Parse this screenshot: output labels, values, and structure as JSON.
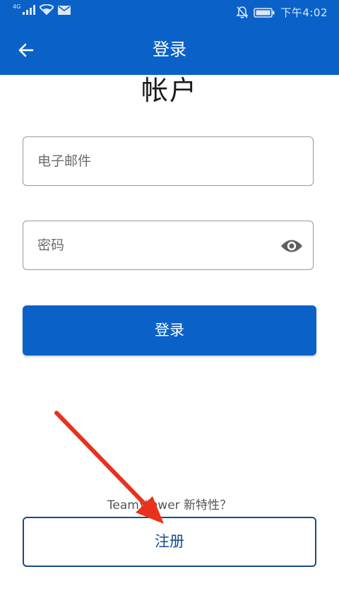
{
  "status_bar": {
    "network_type": "4G",
    "time": "下午4:02",
    "icons": [
      "signal-icon",
      "wifi-icon",
      "mail-icon",
      "mute-bell-icon",
      "battery-icon"
    ]
  },
  "app_bar": {
    "title": "登录",
    "back_icon": "arrow-left-icon"
  },
  "form": {
    "heading": "帐户",
    "email": {
      "placeholder": "电子邮件",
      "value": ""
    },
    "password": {
      "placeholder": "密码",
      "value": "",
      "toggle_icon": "eye-icon"
    },
    "login_label": "登录"
  },
  "footer": {
    "whats_new": "TeamViewer 新特性？",
    "register_label": "注册"
  },
  "colors": {
    "primary": "#0a62c9",
    "register_border": "#174b8e",
    "annotation_arrow": "#e8321c"
  }
}
